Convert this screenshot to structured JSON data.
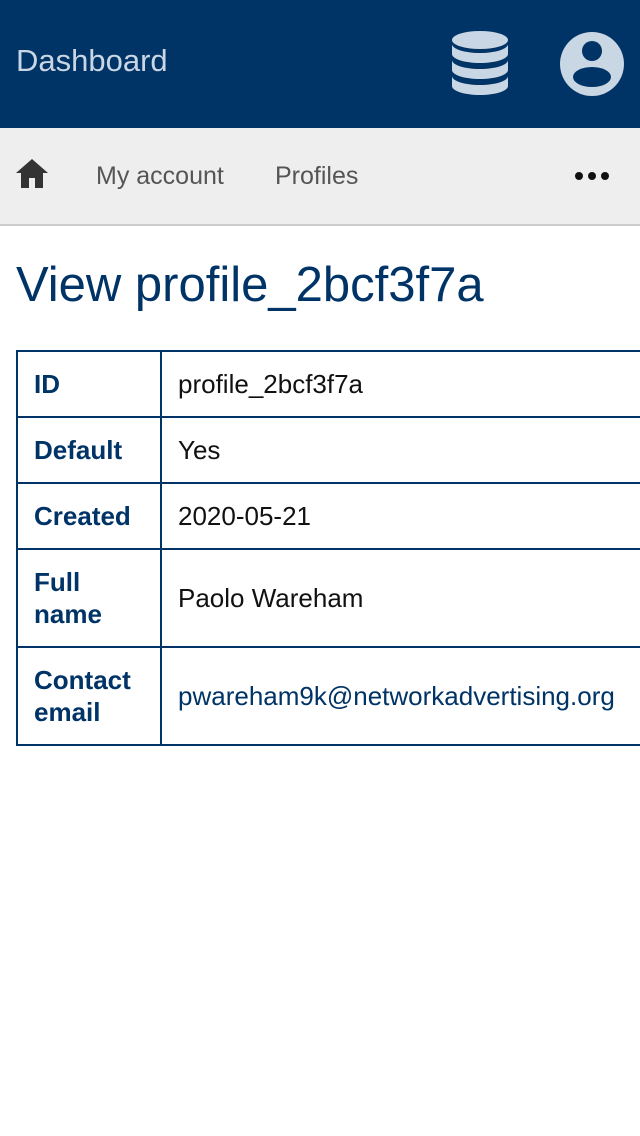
{
  "header": {
    "title": "Dashboard",
    "icons": [
      "database-icon",
      "user-account-icon"
    ]
  },
  "nav": {
    "home_icon": "home-icon",
    "links": [
      "My account",
      "Profiles"
    ],
    "more_icon": "more-horizontal-icon"
  },
  "page": {
    "title": "View profile_2bcf3f7a"
  },
  "profile": {
    "rows": [
      {
        "label": "ID",
        "value": "profile_2bcf3f7a"
      },
      {
        "label": "Default",
        "value": "Yes"
      },
      {
        "label": "Created",
        "value": "2020-05-21"
      },
      {
        "label": "Full name",
        "value": "Paolo Wareham"
      },
      {
        "label": "Contact email",
        "value": "pwareham9k@networkadvertising.org"
      }
    ]
  },
  "colors": {
    "header_bg": "#003366",
    "nav_bg": "#eeeeee",
    "accent": "#003366",
    "header_text": "#c9d6e4",
    "icon_fill": "#c9d6e4"
  }
}
